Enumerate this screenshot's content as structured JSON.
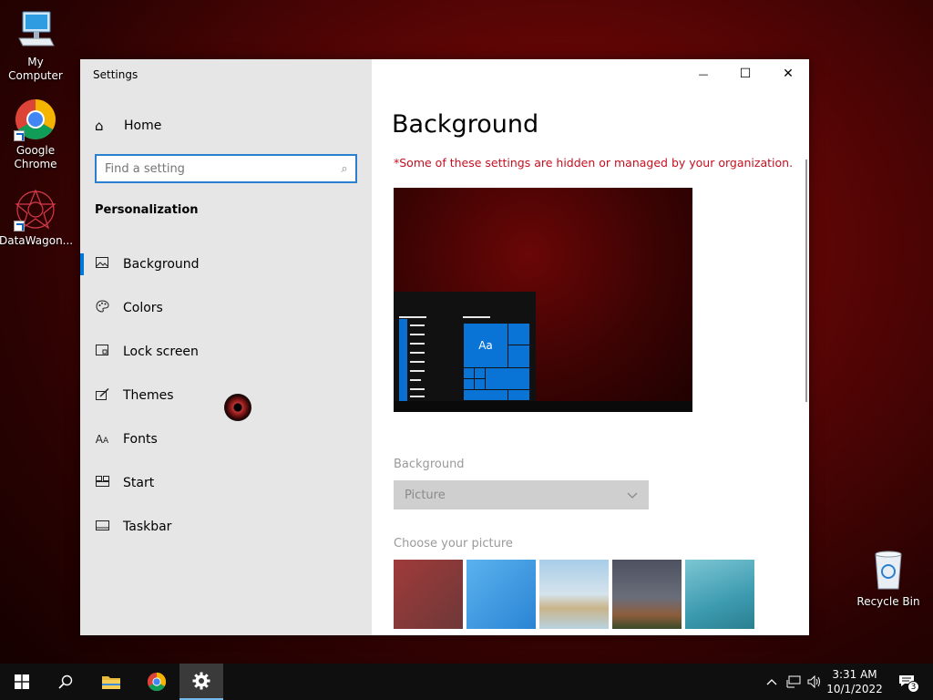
{
  "desktop": {
    "icons": [
      {
        "label": "My Computer",
        "icon": "computer-icon"
      },
      {
        "label": "Google Chrome",
        "icon": "chrome-icon"
      },
      {
        "label": "DataWagon...",
        "icon": "datawagon-icon"
      },
      {
        "label": "Recycle Bin",
        "icon": "recycle-bin-icon"
      }
    ]
  },
  "window": {
    "title": "Settings",
    "controls": {
      "minimize": "—",
      "maximize": "☐",
      "close": "✕"
    }
  },
  "nav": {
    "home_label": "Home",
    "search_placeholder": "Find a setting",
    "section_title": "Personalization",
    "items": [
      {
        "label": "Background",
        "icon": "picture-icon",
        "glyph": "🖼"
      },
      {
        "label": "Colors",
        "icon": "palette-icon",
        "glyph": "🎨"
      },
      {
        "label": "Lock screen",
        "icon": "lock-screen-icon",
        "glyph": "▭"
      },
      {
        "label": "Themes",
        "icon": "brush-icon",
        "glyph": "✎"
      },
      {
        "label": "Fonts",
        "icon": "font-icon",
        "glyph": "A"
      },
      {
        "label": "Start",
        "icon": "start-icon",
        "glyph": "▦"
      },
      {
        "label": "Taskbar",
        "icon": "taskbar-icon",
        "glyph": "▭"
      }
    ],
    "active_index": 0
  },
  "content": {
    "page_title": "Background",
    "managed_notice": "*Some of these settings are hidden or managed by your organization.",
    "preview_tile_text": "Aa",
    "background_label": "Background",
    "background_value": "Picture",
    "choose_label": "Choose your picture",
    "thumbnails": [
      {
        "name": "red-gradient",
        "colors": [
          "#9a3535",
          "#6e3a3a"
        ]
      },
      {
        "name": "windows-blue",
        "colors": [
          "#4aa8e8",
          "#2a88d6"
        ]
      },
      {
        "name": "beach-rocks",
        "colors": [
          "#9fc7e6",
          "#d8c6a0"
        ]
      },
      {
        "name": "night-sky",
        "colors": [
          "#5b5f6c",
          "#8a5a3a"
        ]
      },
      {
        "name": "underwater",
        "colors": [
          "#5fb4c4",
          "#2a7f8f"
        ]
      }
    ]
  },
  "taskbar": {
    "pinned": [
      "start-icon",
      "search-icon",
      "file-explorer-icon",
      "chrome-icon",
      "settings-icon"
    ],
    "time": "3:31 AM",
    "date": "10/1/2022",
    "notification_count": "3"
  },
  "colors": {
    "accent": "#0078d7",
    "managed_red": "#c50f1f"
  }
}
